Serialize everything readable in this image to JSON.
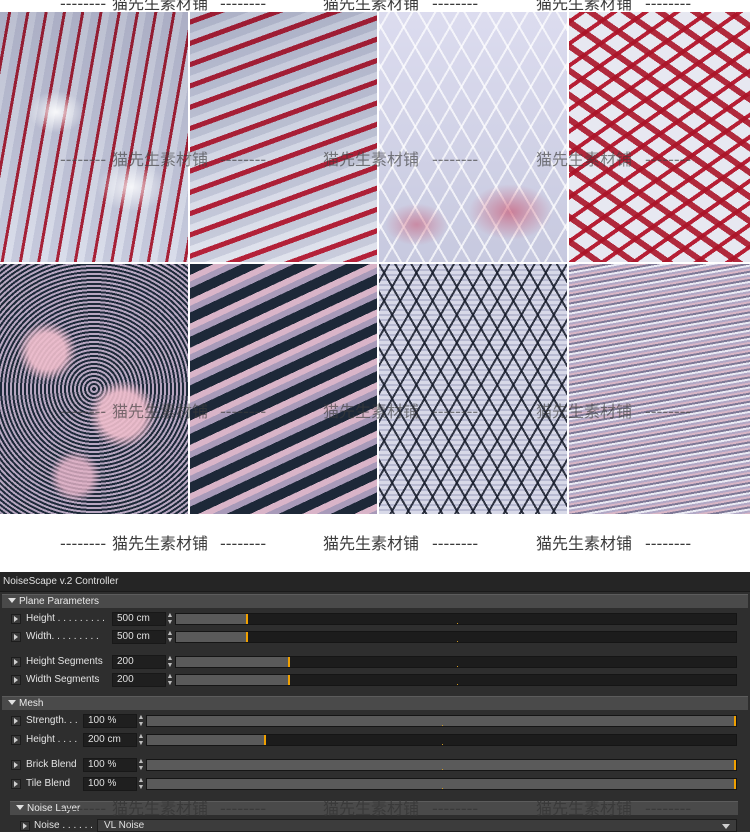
{
  "watermark": {
    "text": "猫先生素材铺",
    "dashes": "--------"
  },
  "panel": {
    "title": "NoiseScape v.2 Controller",
    "sections": {
      "plane": "Plane Parameters",
      "mesh": "Mesh",
      "noise_layer": "Noise Layer"
    },
    "rows": [
      {
        "label": "Height . . . . . . . . .",
        "value": "500 cm",
        "level": 0.1
      },
      {
        "label": "Width. . . . . . . . .",
        "value": "500 cm",
        "level": 0.1
      },
      {
        "label": "Height Segments",
        "value": "200",
        "level": 0.2
      },
      {
        "label": "Width Segments",
        "value": "200",
        "level": 0.2
      },
      {
        "label": "Strength. . .",
        "value": "100 %",
        "level": 1.0
      },
      {
        "label": "Height . . . .",
        "value": "200 cm",
        "level": 0.2
      },
      {
        "label": "Brick Blend",
        "value": "100 %",
        "level": 1.0
      },
      {
        "label": "Tile Blend",
        "value": "100 %",
        "level": 1.0
      }
    ],
    "noise": {
      "label": "Noise . . . . . .",
      "selected": "VL Noise"
    }
  },
  "colors": {
    "panel_bg": "#2e2e2e",
    "accent": "#f0a000"
  }
}
